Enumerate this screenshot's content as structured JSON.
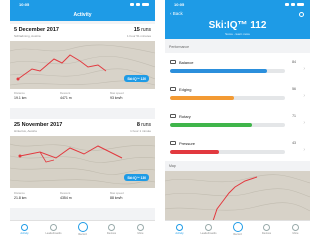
{
  "status": {
    "time": "10:05"
  },
  "activity": {
    "title": "Activity",
    "activities": [
      {
        "date": "5 December 2017",
        "location": "Schladming, Austria",
        "runs_count": "15",
        "runs_unit": "runs",
        "duration": "1 hour 51 minutes",
        "skiiq_badge": "Ski:IQ™ 120",
        "stats": [
          {
            "label": "Distance",
            "value": "19.1 km"
          },
          {
            "label": "Descent",
            "value": "4471 m"
          },
          {
            "label": "Max speed",
            "value": "93 km/h"
          }
        ]
      },
      {
        "date": "25 November 2017",
        "location": "Hintertux, Austria",
        "runs_count": "8",
        "runs_unit": "runs",
        "duration": "1 hour 1 minute",
        "skiiq_badge": "Ski:IQ™ 130",
        "stats": [
          {
            "label": "Distance",
            "value": "21.8 km"
          },
          {
            "label": "Descent",
            "value": "4354 m"
          },
          {
            "label": "Max speed",
            "value": "88 km/h"
          }
        ]
      }
    ]
  },
  "tabs": [
    {
      "label": "Activity",
      "icon": "activity-icon"
    },
    {
      "label": "Leaderboards",
      "icon": "trophy-icon"
    },
    {
      "label": "Record",
      "icon": "record-icon"
    },
    {
      "label": "Devices",
      "icon": "device-icon"
    },
    {
      "label": "More",
      "icon": "more-icon"
    }
  ],
  "detail": {
    "back_label": "Back",
    "title": "Ski:IQ™ 112",
    "subtitle": "Score - learn more",
    "performance_label": "Performance",
    "map_label": "Map",
    "metrics": [
      {
        "name": "Balance",
        "score": "84",
        "fill": 0.84,
        "color": "#2b8fdc",
        "icon": "balance-icon"
      },
      {
        "name": "Edging",
        "score": "56",
        "fill": 0.56,
        "color": "#f39a33",
        "icon": "edging-icon"
      },
      {
        "name": "Rotary",
        "score": "71",
        "fill": 0.71,
        "color": "#3fb54a",
        "icon": "rotary-icon"
      },
      {
        "name": "Pressure",
        "score": "43",
        "fill": 0.43,
        "color": "#e2393f",
        "icon": "pressure-icon"
      }
    ]
  }
}
